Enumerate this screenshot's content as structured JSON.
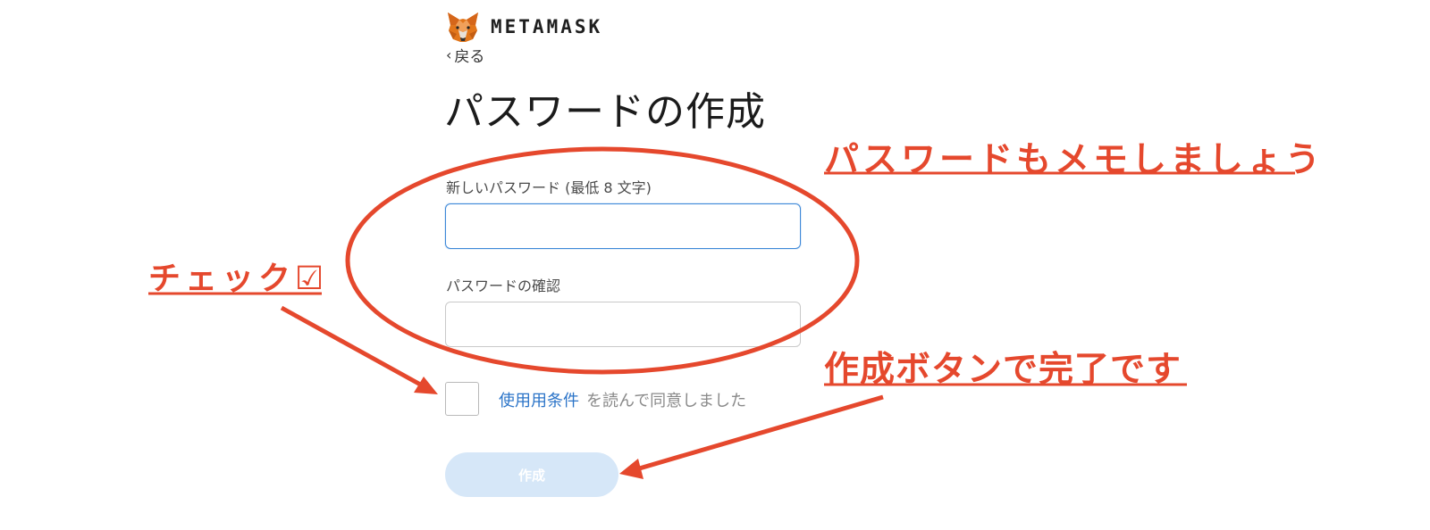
{
  "brand": {
    "name": "METAMASK"
  },
  "nav": {
    "back_label": "戻る"
  },
  "page": {
    "title": "パスワードの作成"
  },
  "form": {
    "new_password_label": "新しいパスワード (最低 8 文字)",
    "new_password_value": "",
    "confirm_password_label": "パスワードの確認",
    "confirm_password_value": "",
    "terms_checked": false,
    "terms_link": "使用用条件",
    "terms_suffix": "を読んで同意しました",
    "create_button": "作成"
  },
  "annotations": {
    "check_text": "チェック☑",
    "memo_text": "パスワードもメモしましょう",
    "done_text": "作成ボタンで完了です",
    "color": "#e5482d"
  },
  "colors": {
    "accent_blue": "#3d88d8",
    "link_blue": "#2b74c8",
    "button_disabled_bg": "#d6e7f8",
    "fox_orange": "#e2761b"
  }
}
